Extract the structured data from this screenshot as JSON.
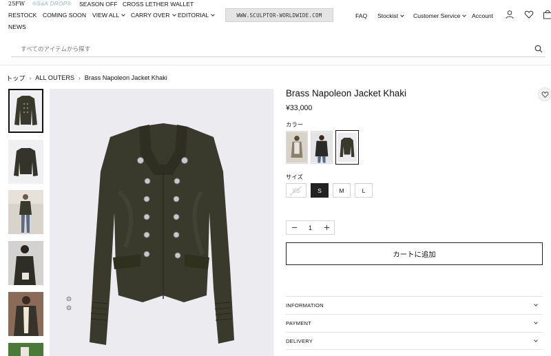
{
  "header": {
    "nav_row1": [
      "25FW",
      "®SaA DROP®",
      "SEASON OFF",
      "CROSS LETHER WALLET"
    ],
    "nav_row2": [
      "RESTOCK",
      "COMING SOON",
      "VIEW ALL",
      "CARRY OVER",
      "EDITORIAL"
    ],
    "nav_row3": [
      "NEWS"
    ],
    "logo_text": "WWW.SCULPTOR-WORLDWIDE.COM",
    "right_links": [
      "FAQ",
      "Stockist",
      "Customer Service",
      "Account"
    ],
    "icons": [
      "user-icon",
      "heart-icon",
      "bag-icon"
    ]
  },
  "search": {
    "placeholder": "すべてのアイテムから探す"
  },
  "breadcrumb": [
    "トップ",
    "ALL OUTERS",
    "Brass Napoleon Jacket Khaki"
  ],
  "product": {
    "title": "Brass Napoleon Jacket Khaki",
    "price": "¥33,000",
    "color_label": "カラー",
    "size_label": "サイズ",
    "sizes": [
      "XS",
      "S",
      "M",
      "L"
    ],
    "selected_size": "S",
    "soldout_size": "XS",
    "quantity": "1",
    "add_to_cart": "カートに追加",
    "accordion": [
      "INFORMATION",
      "PAYMENT",
      "DELIVERY"
    ]
  },
  "colors": {
    "jacket": "#3a3a2c",
    "accent_dark": "#222222",
    "image_bg": "#ececf0"
  }
}
